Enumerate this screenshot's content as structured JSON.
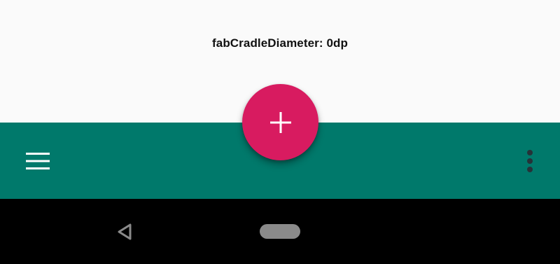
{
  "screen": {
    "caption": "fabCradleDiameter: 0dp"
  },
  "bottom_app_bar": {
    "navigation_icon": "hamburger-menu-icon",
    "overflow_icon": "more-vert-icon",
    "fab_icon": "add-icon"
  },
  "system_nav": {
    "back_icon": "back-triangle-icon",
    "home_icon": "home-pill-icon"
  },
  "colors": {
    "background": "#fafafa",
    "app_bar": "#00796b",
    "fab": "#d81b60",
    "nav_bar": "#000000",
    "icon_light": "#ffffff",
    "icon_dark": "#263238",
    "nav_icon": "#8a8a8a"
  }
}
